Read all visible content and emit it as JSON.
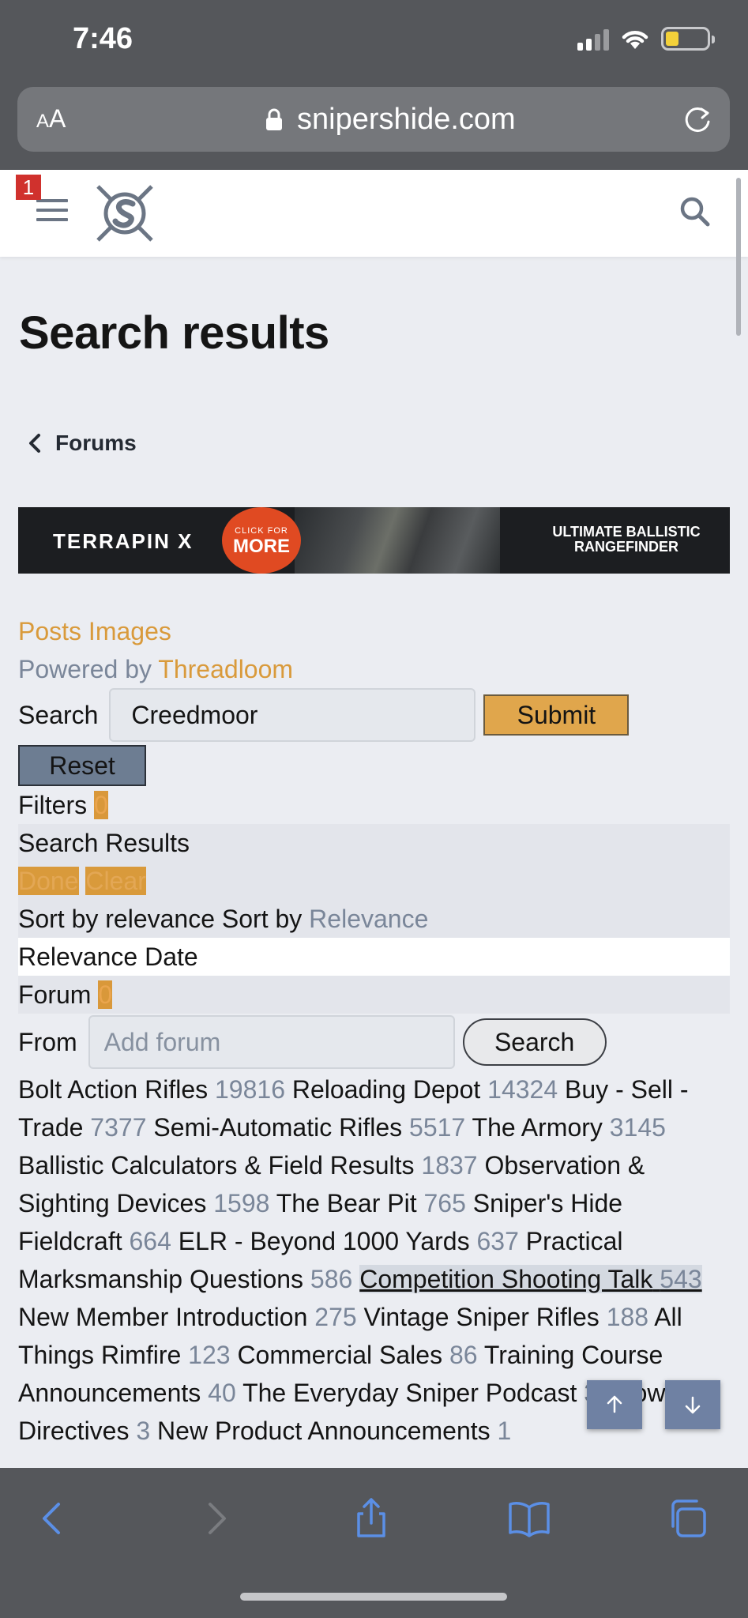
{
  "status": {
    "time": "7:46"
  },
  "browser": {
    "aa": "AA",
    "domain": "snipershide.com"
  },
  "header": {
    "notification_count": "1"
  },
  "page": {
    "title": "Search results",
    "breadcrumb": "Forums"
  },
  "banner": {
    "brand": "TERRAPIN X",
    "cta_small": "CLICK FOR",
    "cta_big": "MORE",
    "tagline": "ULTIMATE BALLISTIC RANGEFINDER"
  },
  "content": {
    "tabs_line": "Posts Images",
    "powered_prefix": "Powered by",
    "powered_link": "Threadloom",
    "search_label": "Search",
    "search_value": "Creedmoor",
    "submit_label": "Submit",
    "reset_label": "Reset",
    "filters_label": "Filters",
    "filters_count": "0",
    "results_label": "Search Results",
    "done_label": "Done",
    "clear_label": "Clear",
    "sort_prefix": "Sort by relevance Sort by",
    "sort_value": "Relevance",
    "sort_options": "Relevance Date",
    "forum_label": "Forum",
    "forum_count": "0",
    "from_label": "From",
    "forum_placeholder": "Add forum",
    "search_button": "Search"
  },
  "forums": [
    {
      "name": "Bolt Action Rifles",
      "count": "19816"
    },
    {
      "name": "Reloading Depot",
      "count": "14324"
    },
    {
      "name": "Buy - Sell - Trade",
      "count": "7377"
    },
    {
      "name": "Semi-Automatic Rifles",
      "count": "5517"
    },
    {
      "name": "The Armory",
      "count": "3145"
    },
    {
      "name": "Ballistic Calculators & Field Results",
      "count": "1837"
    },
    {
      "name": "Observation & Sighting Devices",
      "count": "1598"
    },
    {
      "name": "The Bear Pit",
      "count": "765"
    },
    {
      "name": "Sniper's Hide Fieldcraft",
      "count": "664"
    },
    {
      "name": "ELR - Beyond 1000 Yards",
      "count": "637"
    },
    {
      "name": "Practical Marksmanship Questions",
      "count": "586"
    },
    {
      "name": "Competition Shooting Talk",
      "count": "543",
      "active": true
    },
    {
      "name": "New Member Introduction",
      "count": "275"
    },
    {
      "name": "Vintage Sniper Rifles",
      "count": "188"
    },
    {
      "name": "All Things Rimfire",
      "count": "123"
    },
    {
      "name": "Commercial Sales",
      "count": "86"
    },
    {
      "name": "Training Course Announcements",
      "count": "40"
    },
    {
      "name": "The Everyday Sniper Podcast",
      "count": "31"
    },
    {
      "name": "Lowlight Directives",
      "count": "3"
    },
    {
      "name": "New Product Announcements",
      "count": "1"
    }
  ]
}
